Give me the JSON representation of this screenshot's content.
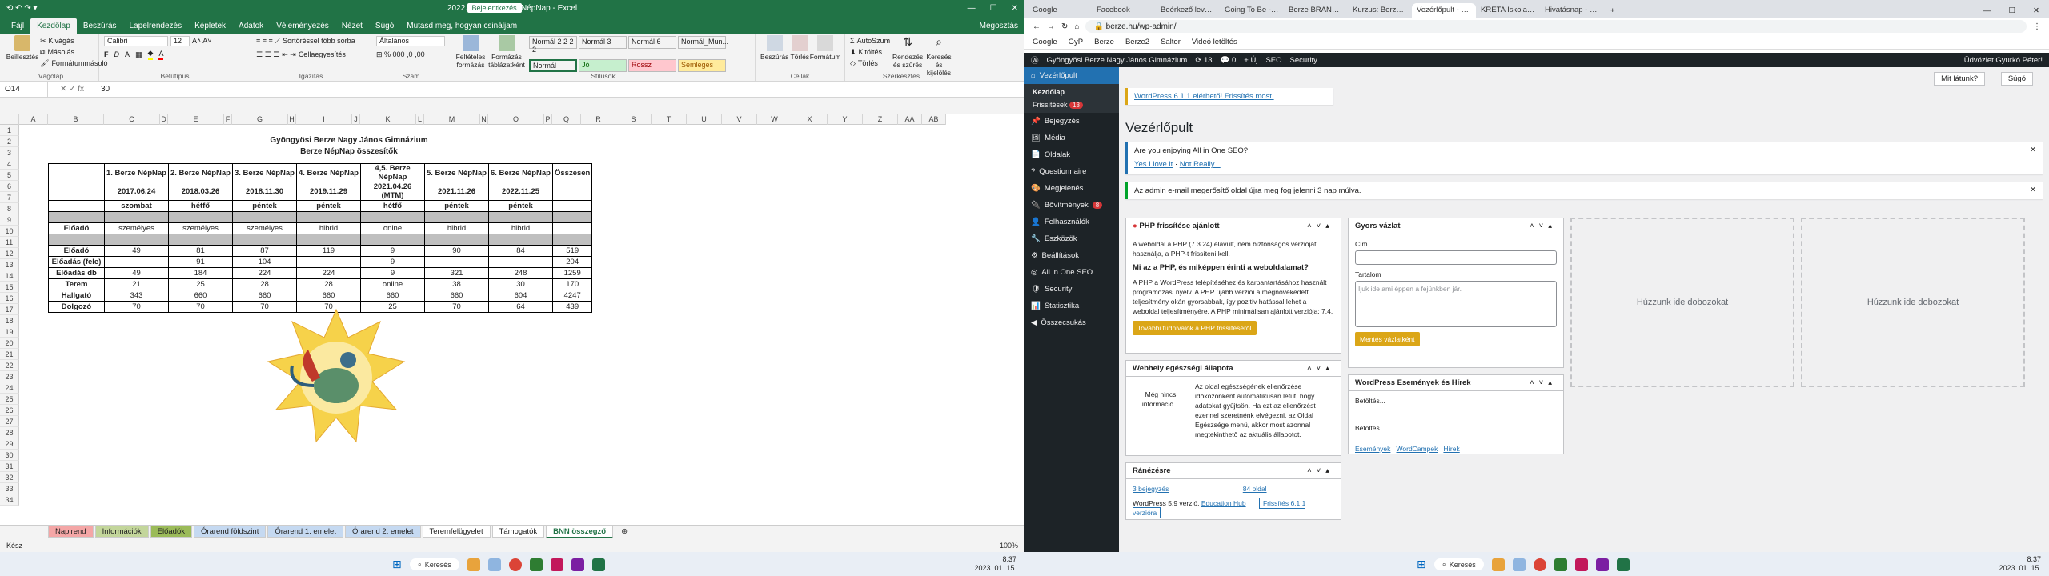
{
  "excel": {
    "window_title": "2022.11.25. 6.Berze NépNap - Excel",
    "signin": "Bejelentkezés",
    "menu_tabs": [
      "Fájl",
      "Kezdőlap",
      "Beszúrás",
      "Lapelrendezés",
      "Képletek",
      "Adatok",
      "Véleményezés",
      "Nézet",
      "Súgó",
      "Mutasd meg, hogyan csináljam"
    ],
    "share": "Megosztás",
    "ribbon": {
      "paste": "Beillesztés",
      "cut": "Kivágás",
      "copy": "Másolás",
      "format_painter": "Formátummásoló",
      "clipboard": "Vágólap",
      "font_name": "Calibri",
      "font_size": "12",
      "font_group": "Betűtípus",
      "wrap": "Sortöréssel több sorba",
      "merge": "Cellaegyesítés",
      "align_group": "Igazítás",
      "number_format": "Általános",
      "number_group": "Szám",
      "cond_format": "Feltételes formázás",
      "format_table": "Formázás táblázatként",
      "styles": [
        "Normál 2 2 2 2",
        "Normál 3",
        "Normál 6",
        "Normál_Mun...",
        "Normál",
        "Jó",
        "Rossz",
        "Semleges"
      ],
      "styles_group": "Stílusok",
      "insert": "Beszúrás",
      "delete": "Törlés",
      "format": "Formátum",
      "cells_group": "Cellák",
      "autosum": "AutoSzum",
      "fill": "Kitöltés",
      "clear": "Törlés",
      "sort": "Rendezés és szűrés",
      "find": "Keresés és kijelölés",
      "edit_group": "Szerkesztés"
    },
    "name_box": "O14",
    "formula": "30",
    "columns": [
      "A",
      "B",
      "C",
      "D",
      "E",
      "F",
      "G",
      "H",
      "I",
      "J",
      "K",
      "L",
      "M",
      "N",
      "O",
      "P",
      "Q",
      "R",
      "S",
      "T",
      "U",
      "V",
      "W",
      "X",
      "Y",
      "Z",
      "AA",
      "AB"
    ],
    "rows": [
      "1",
      "2",
      "3",
      "4",
      "5",
      "6",
      "7",
      "8",
      "9",
      "10",
      "11",
      "12",
      "13",
      "14",
      "15",
      "16",
      "17",
      "18",
      "19",
      "20",
      "21",
      "22",
      "23",
      "24",
      "25",
      "26",
      "27",
      "28",
      "29",
      "30",
      "31",
      "32",
      "33",
      "34"
    ],
    "title1": "Gyöngyösi Berze Nagy János Gimnázium",
    "title2": "Berze NépNap összesítők",
    "table": {
      "headers": [
        "1. Berze NépNap",
        "2. Berze NépNap",
        "3. Berze NépNap",
        "4. Berze NépNap",
        "4,5. Berze NépNap",
        "5. Berze NépNap",
        "6. Berze NépNap",
        "Összesen"
      ],
      "dates": [
        "2017.06.24",
        "2018.03.26",
        "2018.11.30",
        "2019.11.29",
        "2021.04.26 (MTM)",
        "2021.11.26",
        "2022.11.25",
        ""
      ],
      "days": [
        "szombat",
        "hétfő",
        "péntek",
        "péntek",
        "hétfő",
        "péntek",
        "péntek",
        ""
      ],
      "eloado_label": "Előadó",
      "eloado": [
        "személyes",
        "személyes",
        "személyes",
        "hibrid",
        "onine",
        "hibrid",
        "hibrid",
        ""
      ],
      "rows": [
        {
          "label": "Előadó",
          "values": [
            "49",
            "81",
            "87",
            "119",
            "9",
            "90",
            "84",
            "519"
          ]
        },
        {
          "label": "Előadás (fele)",
          "values": [
            "",
            "91",
            "104",
            "",
            "9",
            "",
            "",
            "204"
          ]
        },
        {
          "label": "Előadás db",
          "values": [
            "49",
            "184",
            "224",
            "224",
            "9",
            "321",
            "248",
            "1259"
          ]
        },
        {
          "label": "Terem",
          "values": [
            "21",
            "25",
            "28",
            "28",
            "online",
            "38",
            "30",
            "170"
          ]
        },
        {
          "label": "Hallgató",
          "values": [
            "343",
            "660",
            "660",
            "660",
            "660",
            "660",
            "604",
            "4247"
          ]
        },
        {
          "label": "Dolgozó",
          "values": [
            "70",
            "70",
            "70",
            "70",
            "25",
            "70",
            "64",
            "439"
          ]
        }
      ]
    },
    "sheet_tabs": [
      "Napirend",
      "Információk",
      "Előadók",
      "Órarend földszint",
      "Órarend 1. emelet",
      "Órarend 2. emelet",
      "Teremfelügyelet",
      "Támogatók",
      "BNN összegző"
    ],
    "status": "Kész",
    "zoom": "100%"
  },
  "browser": {
    "tabs": [
      "Google",
      "Facebook",
      "Beérkező levelek - gyö",
      "Going To Be - \"A hol\"",
      "Berze BRAND | Gyöngy",
      "Kurzus: Berze NépNap",
      "Vezérlőpult - Gyöngy",
      "KRÉTA Iskolai Alaprer",
      "Hivatásnap - ahol kp"
    ],
    "url": "berze.hu/wp-admin/",
    "bookmarks": [
      "Google",
      "GyP",
      "Berze",
      "Berze2",
      "Saltor",
      "Videó letöltés"
    ],
    "adminbar": {
      "site": "Gyöngyösi Berze Nagy János Gimnázium",
      "updates": "13",
      "comments": "0",
      "new": "Új",
      "seo": "SEO",
      "security": "Security",
      "howdy": "Üdvözlet Gyurkó Péter!"
    },
    "sidebar": [
      "Vezérlőpult",
      "Kezdőlap",
      "Frissítések",
      "Bejegyzés",
      "Média",
      "Oldalak",
      "Questionnaire",
      "Megjelenés",
      "Bővítmények",
      "Felhasználók",
      "Eszközök",
      "Beállítások",
      "All in One SEO",
      "Security",
      "Statisztika",
      "Összecsukás"
    ],
    "updates_badge": "13",
    "plugins_badge": "8",
    "screen_options": "Mit látunk?",
    "help": "Súgó",
    "update_notice": "WordPress 6.1.1 elérhető! Frissítés most.",
    "page_title": "Vezérlőpult",
    "aioseo_q": "Are you enjoying All in One SEO?",
    "aioseo_yes": "Yes I love it",
    "aioseo_no": "Not Really...",
    "email_notice": "Az admin e-mail megerősítő oldal újra meg fog jelenni 3 nap múlva.",
    "php_box": {
      "title": "PHP frissítése ajánlott",
      "p1": "A weboldal a PHP (7.3.24) elavult, nem biztonságos verzióját használja, a PHP-t frissíteni kell.",
      "h": "Mi az a PHP, és miképpen érinti a weboldalamat?",
      "p2": "A PHP a WordPress felépítéséhez és karbantartásához használt programozási nyelv. A PHP újabb verziói a megnövekedett teljesítmény okán gyorsabbak, így pozitív hatással lehet a weboldal teljesítményére. A PHP minimálisan ajánlott verziója: 7.4.",
      "button": "További tudnivalók a PHP frissítéséről"
    },
    "health_box": {
      "title": "Webhely egészségi állapota",
      "status": "Még nincs információ...",
      "text": "Az oldal egészségének ellenőrzése időközönként automatikusan lefut, hogy adatokat gyűjtsön. Ha ezt az ellenőrzést ezennel szeretnénk elvégezni, az Oldal Egészsége menü, akkor most azonnal megtekinthető az aktuális állapotot."
    },
    "glance_box": {
      "title": "Ránézésre",
      "posts": "3 bejegyzés",
      "pages": "84 oldal",
      "version": "WordPress 5.9 verzió.",
      "theme": "Education Hub",
      "upd_btn": "Frissítés 6.1.1 verzióra"
    },
    "draft_box": {
      "title": "Gyors vázlat",
      "label_title": "Cím",
      "label_content": "Tartalom",
      "placeholder": "Ijuk ide ami éppen a fejünkben jár.",
      "button": "Mentés vázlatként"
    },
    "events_box": {
      "title": "WordPress Események és Hírek",
      "loading1": "Betöltés...",
      "loading2": "Betöltés...",
      "events": "Események",
      "wordcamps": "WordCampek",
      "news": "Hírek"
    },
    "dropzone": "Húzzunk ide dobozokat"
  },
  "taskbar": {
    "search": "Keresés",
    "time": "8:37",
    "date": "2023. 01. 15."
  },
  "colors": {
    "excel_green": "#217346",
    "wp_dark": "#1d2327",
    "wp_blue": "#2271b1",
    "wp_yellow": "#dba617"
  }
}
